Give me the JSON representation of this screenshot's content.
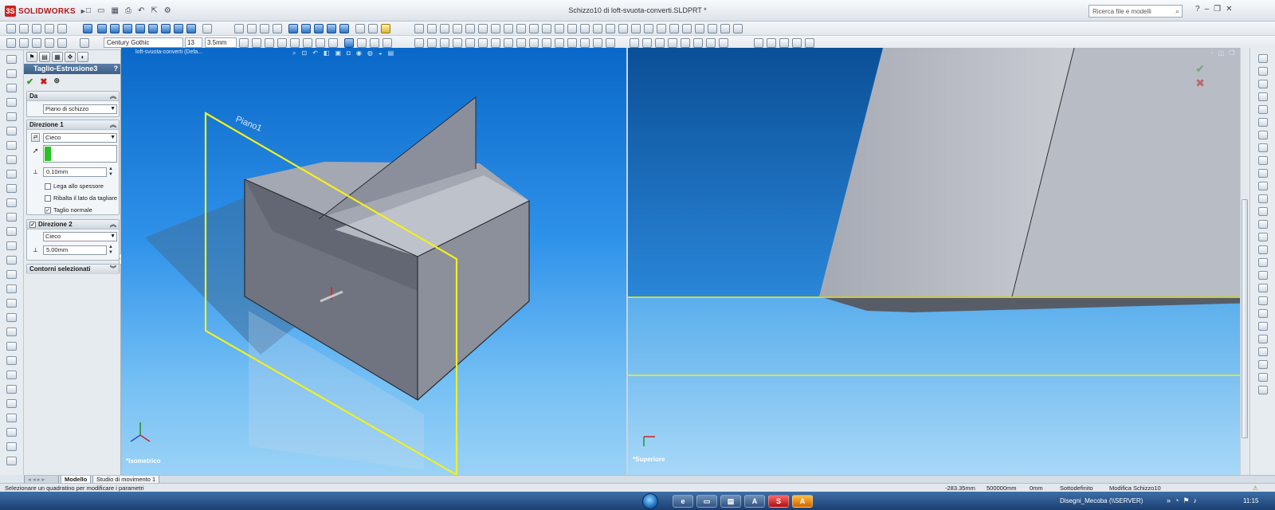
{
  "app": {
    "brand": "SOLIDWORKS",
    "window_title": "Schizzo10 di loft-svuota-converti.SLDPRT *"
  },
  "search": {
    "placeholder": "Ricerca file e modelli"
  },
  "toolbar_text": {
    "font": "Century Gothic",
    "size": "13",
    "height": "3.5mm"
  },
  "property_manager": {
    "feature_title": "Taglio-Estrusione3",
    "help": "?",
    "from_group": {
      "header": "Da",
      "value": "Piano di schizzo"
    },
    "direction1": {
      "header": "Direzione 1",
      "end_condition": "Cieco",
      "depth": "0.10mm",
      "options": [
        {
          "label": "Lega allo spessore",
          "checked": false
        },
        {
          "label": "Ribalta il lato da tagliare",
          "checked": false
        },
        {
          "label": "Taglio normale",
          "checked": true
        }
      ]
    },
    "direction2": {
      "header": "Direzione 2",
      "checked": true,
      "end_condition": "Cieco",
      "depth": "5.00mm"
    },
    "selected_contours": {
      "header": "Contorni selezionati"
    }
  },
  "viewports": {
    "left": {
      "tree_label": "loft-svuota-converti  (Defa...",
      "view_name": "*Isometrico",
      "plane_label": "Piano1"
    },
    "right": {
      "view_name": "*Superiore"
    }
  },
  "bottom_tabs": [
    "Modello",
    "Studio di movimento 1"
  ],
  "status": {
    "hint": "Selezionare un quadratino per modificare i parametri",
    "x": "-283.35mm",
    "y": "500000mm",
    "z": "0mm",
    "state": "Sottodefinito",
    "mode": "Modifica Schizzo10"
  },
  "taskbar": {
    "network": "Disegni_Mecoba (\\\\SERVER)",
    "clock": "11:15"
  },
  "colors": {
    "viewport_top": "#0a68c8",
    "viewport_bottom": "#9ad2f6",
    "sketch_line": "#f2f01e",
    "solid_gray": "#8f939e",
    "accent_red": "#b01818"
  }
}
